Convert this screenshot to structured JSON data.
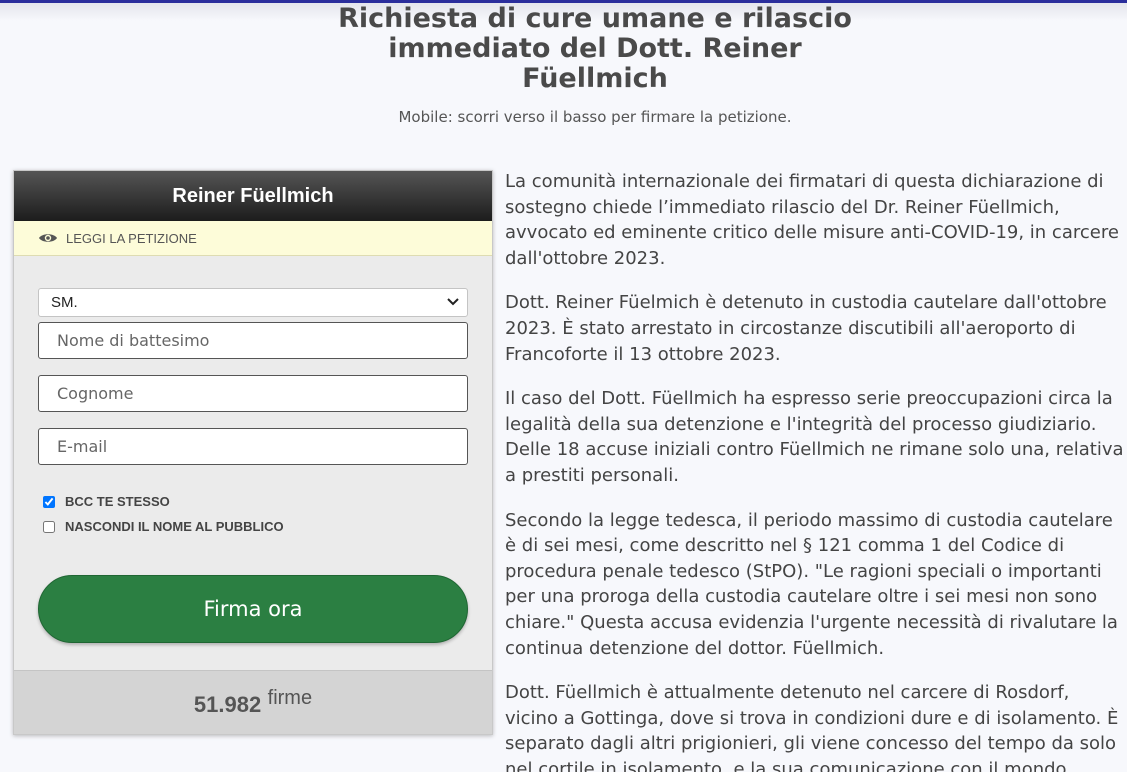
{
  "page": {
    "title": "Richiesta di cure umane e rilascio immediato del Dott. Reiner Füellmich",
    "mobile_hint": "Mobile: scorri verso il basso per firmare la petizione."
  },
  "petition_panel": {
    "header": "Reiner Füellmich",
    "read_petition_label": "LEGGI LA PETIZIONE",
    "read_icon": "eye-icon",
    "salutation_selected": "SM.",
    "first_name_placeholder": "Nome di battesimo",
    "last_name_placeholder": "Cognome",
    "email_placeholder": "E-mail",
    "bcc_label": "BCC TE STESSO",
    "bcc_checked": true,
    "hide_name_label": "NASCONDI IL NOME AL PUBBLICO",
    "hide_name_checked": false,
    "sign_button_label": "Firma ora",
    "signature_count": "51.982",
    "signature_unit": "firme"
  },
  "article": {
    "paragraphs": [
      "La comunità internazionale dei firmatari di questa dichiarazione di sostegno chiede l’immediato rilascio del Dr. Reiner Füellmich, avvocato ed eminente critico delle misure anti-COVID-19, in carcere dall'ottobre 2023.",
      "Dott. Reiner Füelmich è detenuto in custodia cautelare dall'ottobre 2023. È stato arrestato in circostanze discutibili all'aeroporto di Francoforte il 13 ottobre 2023.",
      "Il caso del Dott. Füellmich ha espresso serie preoccupazioni circa la legalità della sua detenzione e l'integrità del processo giudiziario. Delle 18 accuse iniziali contro Füellmich ne rimane solo una, relativa a prestiti personali.",
      "Secondo la legge tedesca, il periodo massimo di custodia cautelare è di sei mesi, come descritto nel § 121 comma 1 del Codice di procedura penale tedesco (StPO). \"Le ragioni speciali o importanti per una proroga della custodia cautelare oltre i sei mesi non sono chiare.\" Questa accusa evidenzia l'urgente necessità di rivalutare la continua detenzione del dottor. Füellmich.",
      "Dott. Füellmich è attualmente detenuto nel carcere di Rosdorf, vicino a Gottinga, dove si trova in condizioni dure e di isolamento. È separato dagli altri prigionieri, gli viene concesso del tempo da solo nel cortile in isolamento, e la sua comunicazione con il mondo"
    ]
  },
  "colors": {
    "accent_bar": "#2b2e9c",
    "sign_button": "#2b7f42",
    "read_bar_bg": "#fdfcd9"
  }
}
